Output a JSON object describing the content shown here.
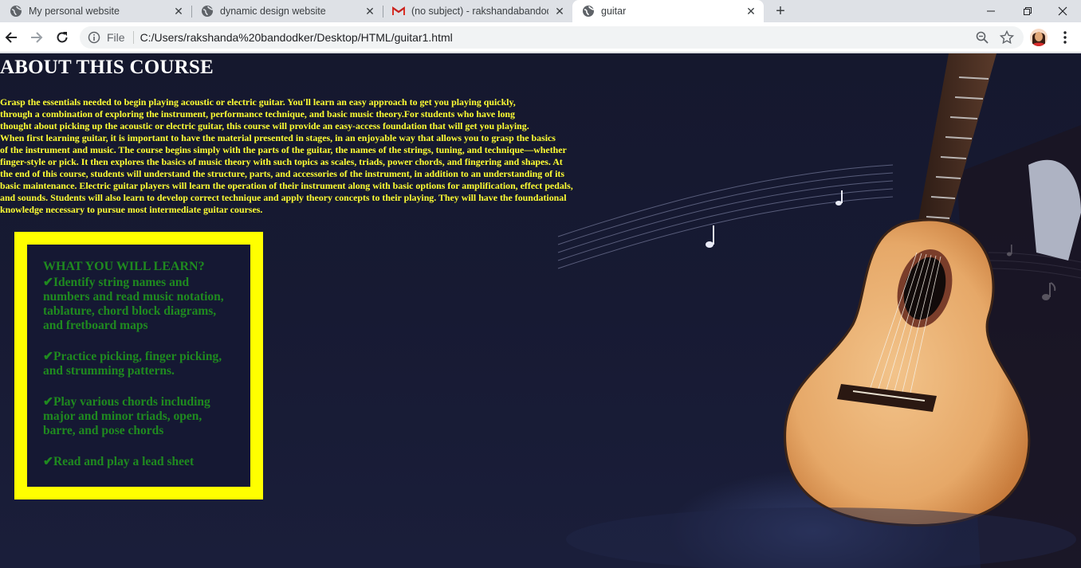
{
  "browser": {
    "tabs": [
      {
        "title": "My personal website",
        "favicon": "globe-icon",
        "active": false
      },
      {
        "title": "dynamic design website",
        "favicon": "globe-icon",
        "active": false
      },
      {
        "title": "(no subject) - rakshandabandodk",
        "favicon": "gmail-icon",
        "active": false
      },
      {
        "title": "guitar",
        "favicon": "globe-icon",
        "active": true
      }
    ],
    "new_tab_label": "+",
    "address": {
      "scheme_label": "File",
      "url": "C:/Users/rakshanda%20bandodker/Desktop/HTML/guitar1.html"
    }
  },
  "page": {
    "heading": "ABOUT THIS COURSE",
    "intro_lines": [
      "Grasp the essentials needed to begin playing acoustic or electric guitar. You'll learn an easy approach to get you playing quickly,",
      "through a combination of exploring the instrument, performance technique, and basic music theory.For students who have long",
      "thought about picking up the acoustic or electric guitar, this course will provide an easy-access foundation that will get you playing.",
      "When first learning guitar, it is important to have the material presented in stages, in an enjoyable way that allows you to grasp the basics",
      "of the instrument and music. The course begins simply with the parts of the guitar, the names of the strings, tuning, and technique—whether",
      "finger-style or pick. It then explores the basics of music theory with such topics as scales, triads, power chords, and fingering and shapes. At",
      "the end of this course, students will understand the structure, parts, and accessories of the instrument, in addition to an understanding of its",
      "basic maintenance. Electric guitar players will learn the operation of their instrument along with basic options for amplification, effect pedals,",
      "and sounds. Students will also learn to develop correct technique and apply theory concepts to their playing. They will have the foundational",
      "knowledge necessary to pursue most intermediate guitar courses."
    ],
    "learn_box": {
      "title": "WHAT YOU WILL LEARN?",
      "items": [
        "✔Identify string names and numbers and read music notation, tablature, chord block diagrams, and fretboard maps",
        "✔Practice picking, finger picking, and strumming patterns.",
        "✔Play various chords including major and minor triads, open, barre, and pose chords",
        "✔Read and play a lead sheet"
      ]
    }
  },
  "colors": {
    "page_bg": "#15182e",
    "heading": "#ffffff",
    "intro_text": "#ffff33",
    "box_border": "#ffff00",
    "box_text": "#1f8a1f"
  }
}
